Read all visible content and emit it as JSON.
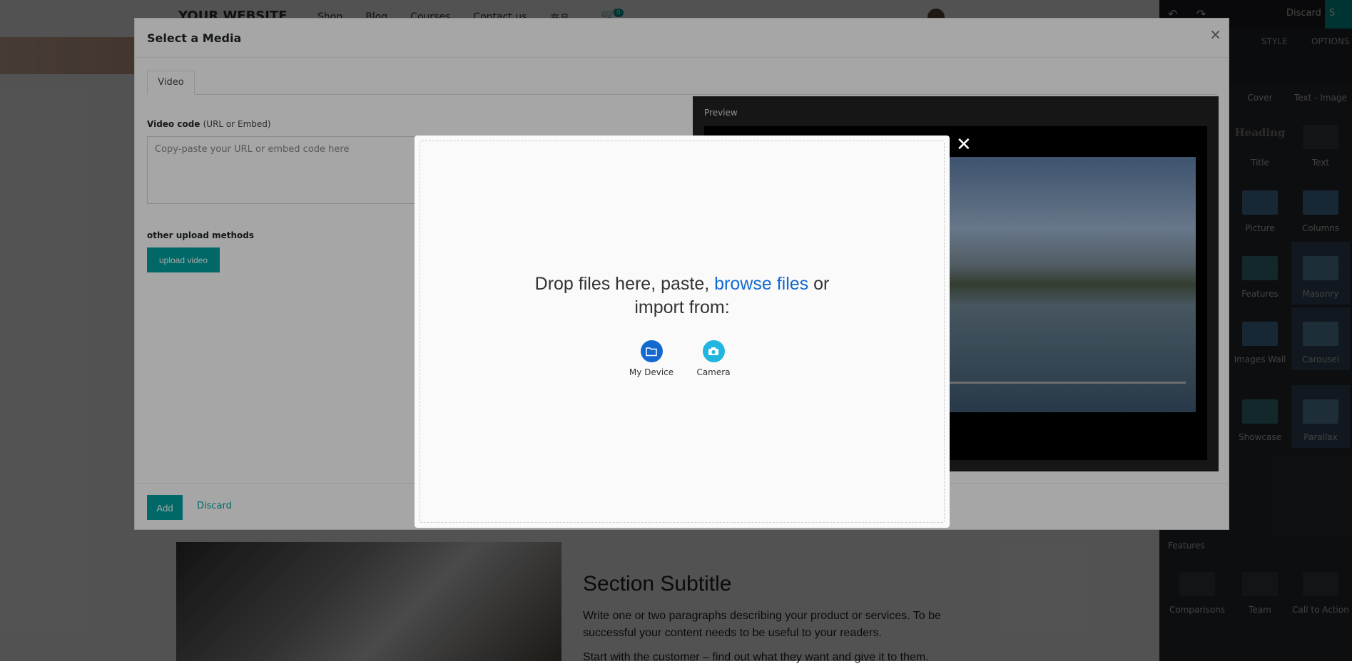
{
  "site": {
    "brand": "YOUR WEBSITE",
    "menu": [
      "Shop",
      "Blog",
      "Courses",
      "Contact us",
      "产品"
    ],
    "cart_count": "0",
    "section_title": "Section Subtitle",
    "section_paragraph": "Write one or two paragraphs describing your product or services. To be successful your content needs to be useful to your readers.",
    "section_paragraph2": "Start with the customer – find out what they want and give it to them."
  },
  "editor": {
    "discard_label": "Discard",
    "save_label": "S",
    "tabs": {
      "style": "STYLE",
      "options": "OPTIONS"
    },
    "snippets": [
      "Cover",
      "Text - Image",
      "Title",
      "Text",
      "Picture",
      "Columns",
      "Features",
      "Masonry",
      "Images Wall",
      "Carousel",
      "Showcase",
      "Parallax"
    ],
    "heading_thumb": "Heading",
    "features_category": "Features",
    "features_snippets": [
      "Comparisons",
      "Team",
      "Call to Action"
    ]
  },
  "media_modal": {
    "title": "Select a Media",
    "close": "×",
    "tab_video": "Video",
    "video_code_label": "Video code",
    "video_code_hint": "(URL or Embed)",
    "video_code_placeholder": "Copy-paste your URL or embed code here",
    "other_methods": "other upload methods",
    "upload_video": "upload video",
    "preview_label": "Preview",
    "add_label": "Add",
    "discard_label": "Discard"
  },
  "upload_dialog": {
    "close": "✕",
    "drop_text_before": "Drop files here, paste, ",
    "browse_link": "browse files",
    "drop_text_after": " or",
    "drop_text_line2": "import from:",
    "sources": [
      {
        "label": "My Device",
        "color": "#1269cf",
        "icon": "folder-icon"
      },
      {
        "label": "Camera",
        "color": "#22b5e0",
        "icon": "camera-icon"
      }
    ]
  }
}
